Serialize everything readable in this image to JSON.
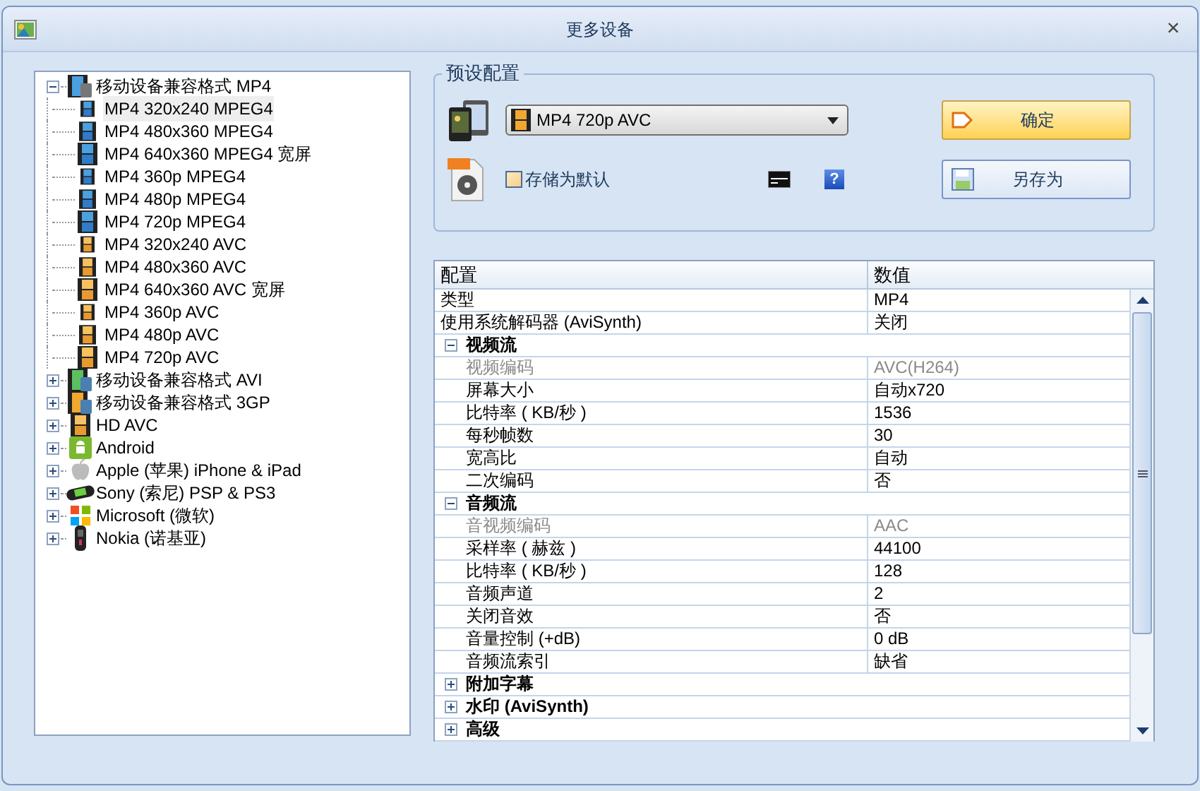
{
  "window": {
    "title": "更多设备",
    "close": "×"
  },
  "tree": [
    {
      "label": "移动设备兼容格式 MP4",
      "kind": "mp4",
      "expanded": true,
      "selected": false,
      "children": [
        {
          "label": "MP4 320x240 MPEG4",
          "kind": "mpeg4",
          "selected": true
        },
        {
          "label": "MP4 480x360 MPEG4",
          "kind": "mpeg4",
          "selected": false
        },
        {
          "label": "MP4 640x360 MPEG4 宽屏",
          "kind": "mpeg4",
          "selected": false
        },
        {
          "label": "MP4 360p MPEG4",
          "kind": "mpeg4",
          "selected": false
        },
        {
          "label": "MP4 480p MPEG4",
          "kind": "mpeg4",
          "selected": false
        },
        {
          "label": "MP4 720p MPEG4",
          "kind": "mpeg4",
          "selected": false
        },
        {
          "label": "MP4 320x240 AVC",
          "kind": "avc",
          "selected": false
        },
        {
          "label": "MP4 480x360 AVC",
          "kind": "avc",
          "selected": false
        },
        {
          "label": "MP4 640x360 AVC 宽屏",
          "kind": "avc",
          "selected": false
        },
        {
          "label": "MP4 360p AVC",
          "kind": "avc",
          "selected": false
        },
        {
          "label": "MP4 480p AVC",
          "kind": "avc",
          "selected": false
        },
        {
          "label": "MP4 720p AVC",
          "kind": "avc",
          "selected": false
        }
      ]
    },
    {
      "label": "移动设备兼容格式 AVI",
      "kind": "avi",
      "expanded": false,
      "selected": false
    },
    {
      "label": "移动设备兼容格式 3GP",
      "kind": "threegp",
      "expanded": false,
      "selected": false
    },
    {
      "label": "HD AVC",
      "kind": "hd",
      "expanded": false,
      "selected": false
    },
    {
      "label": "Android",
      "kind": "android",
      "expanded": false,
      "selected": false
    },
    {
      "label": "Apple (苹果) iPhone & iPad",
      "kind": "apple",
      "expanded": false,
      "selected": false
    },
    {
      "label": "Sony (索尼) PSP & PS3",
      "kind": "sony",
      "expanded": false,
      "selected": false
    },
    {
      "label": "Microsoft (微软)",
      "kind": "microsoft",
      "expanded": false,
      "selected": false
    },
    {
      "label": "Nokia (诺基亚)",
      "kind": "nokia",
      "expanded": false,
      "selected": false
    }
  ],
  "preset": {
    "title": "预设配置",
    "dropdown": "MP4 720p AVC",
    "save_default": {
      "label": "存储为默认",
      "checked": false
    },
    "ok_button": "确定",
    "save_as_button": "另存为",
    "help": "?"
  },
  "grid": {
    "columns": [
      "配置",
      "数值"
    ],
    "rows": [
      {
        "kind": "row",
        "name": "类型",
        "value": "MP4",
        "disabled": false
      },
      {
        "kind": "row",
        "name": "使用系统解码器 (AviSynth)",
        "value": "关闭",
        "disabled": false
      },
      {
        "kind": "section",
        "name": "视频流",
        "expanded": true
      },
      {
        "kind": "row",
        "name": "视频编码",
        "value": "AVC(H264)",
        "disabled": true
      },
      {
        "kind": "row",
        "name": "屏幕大小",
        "value": "自动x720",
        "disabled": false
      },
      {
        "kind": "row",
        "name": "比特率 ( KB/秒 )",
        "value": "1536",
        "disabled": false
      },
      {
        "kind": "row",
        "name": "每秒帧数",
        "value": "30",
        "disabled": false
      },
      {
        "kind": "row",
        "name": "宽高比",
        "value": "自动",
        "disabled": false
      },
      {
        "kind": "row",
        "name": "二次编码",
        "value": "否",
        "disabled": false
      },
      {
        "kind": "section",
        "name": "音频流",
        "expanded": true
      },
      {
        "kind": "row",
        "name": "音视频编码",
        "value": "AAC",
        "disabled": true
      },
      {
        "kind": "row",
        "name": "采样率 ( 赫兹 )",
        "value": "44100",
        "disabled": false
      },
      {
        "kind": "row",
        "name": "比特率 ( KB/秒 )",
        "value": "128",
        "disabled": false
      },
      {
        "kind": "row",
        "name": "音频声道",
        "value": "2",
        "disabled": false
      },
      {
        "kind": "row",
        "name": "关闭音效",
        "value": "否",
        "disabled": false
      },
      {
        "kind": "row",
        "name": "音量控制 (+dB)",
        "value": "0 dB",
        "disabled": false
      },
      {
        "kind": "row",
        "name": "音频流索引",
        "value": "缺省",
        "disabled": false
      },
      {
        "kind": "section",
        "name": "附加字幕",
        "expanded": false
      },
      {
        "kind": "section",
        "name": "水印 (AviSynth)",
        "expanded": false
      },
      {
        "kind": "section",
        "name": "高级",
        "expanded": false
      }
    ]
  }
}
